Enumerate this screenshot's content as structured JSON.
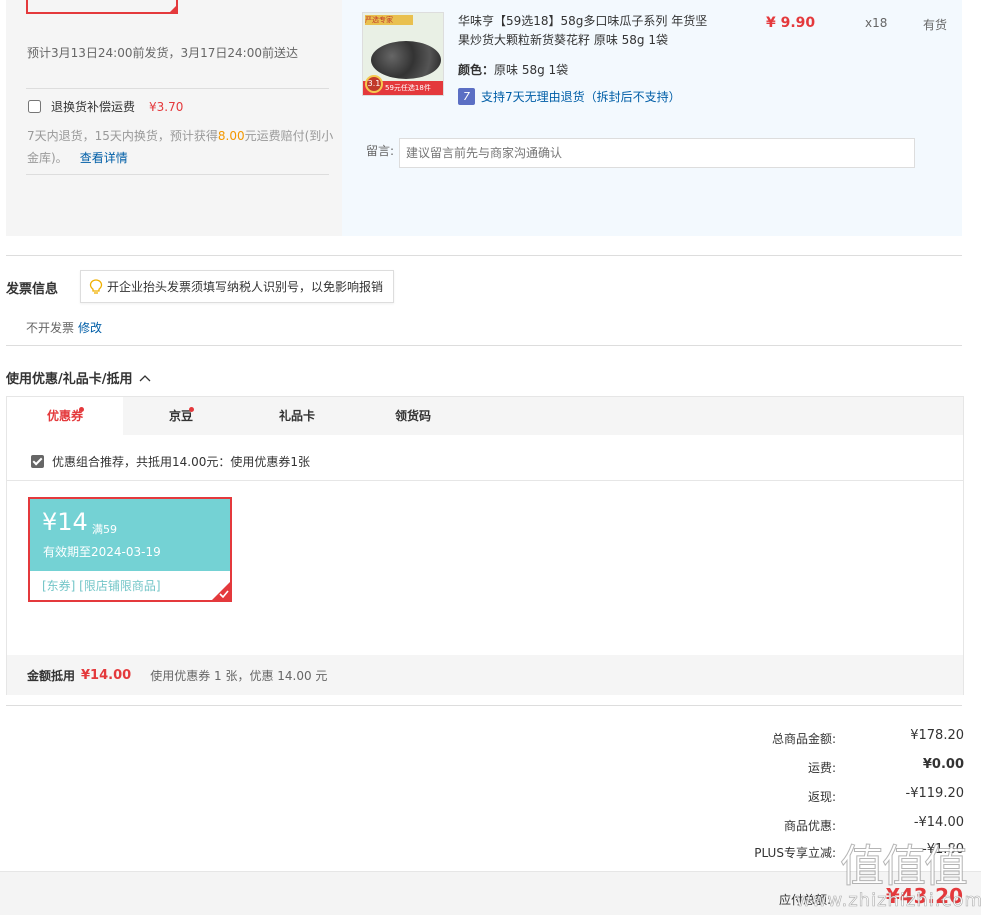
{
  "order": {
    "ship_estimate": "预计3月13日24:00前发货，3月17日24:00前送达",
    "insurance_label": "退换货补偿运费",
    "insurance_price": "¥3.70",
    "return_note_prefix": "7天内退货，15天内换货，预计获得",
    "return_note_amount": "8.00",
    "return_note_suffix": "元运费赔付(到小金库)。",
    "return_note_link": "查看详情",
    "product": {
      "thumb_tag": "严选专家",
      "thumb_ribbon": "59元任选18件",
      "thumb_badge": "3.1",
      "name": "华味亨【59选18】58g多口味瓜子系列 年货坚果炒货大颗粒新货葵花籽 原味 58g 1袋",
      "price": "¥ 9.90",
      "quantity": "x18",
      "stock": "有货",
      "color_label": "颜色：",
      "color_value": "原味 58g 1袋",
      "return_icon": "7",
      "return_policy": "支持7天无理由退货（拆封后不支持）"
    },
    "message_label": "留言:",
    "message_placeholder": "建议留言前先与商家沟通确认"
  },
  "invoice": {
    "title": "发票信息",
    "tip": "开企业抬头发票须填写纳税人识别号，以免影响报销",
    "status": "不开发票",
    "edit": "修改"
  },
  "coupons": {
    "title": "使用优惠/礼品卡/抵用",
    "tabs": [
      {
        "label": "优惠券",
        "dot": true,
        "active": true
      },
      {
        "label": "京豆",
        "dot": true,
        "active": false
      },
      {
        "label": "礼品卡",
        "dot": false,
        "active": false
      },
      {
        "label": "领货码",
        "dot": false,
        "active": false
      }
    ],
    "combo_text": "优惠组合推荐，共抵用14.00元：使用优惠券1张",
    "card": {
      "amount": "¥14",
      "condition": "满59",
      "expiry": "有效期至2024-03-19",
      "scope": "[东券] [限店铺限商品]"
    },
    "summary_label": "金额抵用",
    "summary_value": "¥14.00",
    "summary_desc": "使用优惠券 1 张，优惠 14.00 元"
  },
  "totals": {
    "rows": [
      {
        "label": "总商品金额:",
        "value": "¥178.20",
        "bold": false
      },
      {
        "label": "运费:",
        "value": "¥0.00",
        "bold": true
      },
      {
        "label": "返现:",
        "value": "-¥119.20",
        "bold": false
      },
      {
        "label": "商品优惠:",
        "value": "-¥14.00",
        "bold": false
      },
      {
        "label": "PLUS专享立减:",
        "value": "-¥1.80",
        "bold": false
      }
    ],
    "pay_label": "应付总额:",
    "pay_value": "¥43.20"
  },
  "watermark": {
    "logo": "值值值",
    "text": "www.zhizhizhi.com"
  },
  "colors": {
    "accent_red": "#e4393c",
    "link_blue": "#005ea7",
    "coupon_teal": "#74d2d4",
    "highlight_orange": "#f39800"
  }
}
